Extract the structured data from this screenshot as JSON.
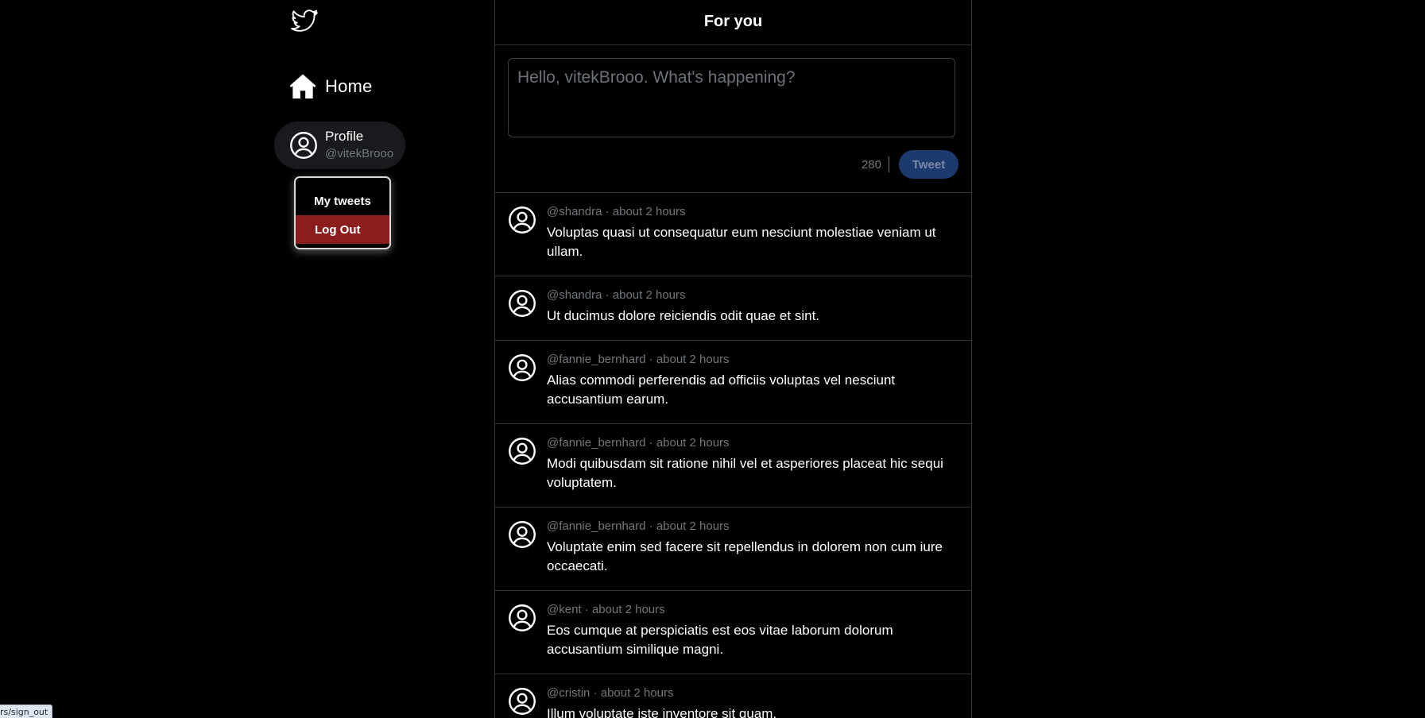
{
  "sidebar": {
    "home_label": "Home",
    "profile": {
      "name": "Profile",
      "handle": "@vitekBrooo"
    },
    "dropdown": {
      "my_tweets": "My tweets",
      "log_out": "Log Out"
    }
  },
  "main": {
    "title": "For you",
    "composer": {
      "placeholder": "Hello, vitekBrooo. What's happening?",
      "char_count": "280",
      "tweet_button": "Tweet"
    },
    "tweets": [
      {
        "meta": "@shandra · about 2 hours",
        "text": "Voluptas quasi ut consequatur eum nesciunt molestiae veniam ut ullam."
      },
      {
        "meta": "@shandra · about 2 hours",
        "text": "Ut ducimus dolore reiciendis odit quae et sint."
      },
      {
        "meta": "@fannie_bernhard · about 2 hours",
        "text": "Alias commodi perferendis ad officiis voluptas vel nesciunt accusantium earum."
      },
      {
        "meta": "@fannie_bernhard · about 2 hours",
        "text": "Modi quibusdam sit ratione nihil vel et asperiores placeat hic sequi voluptatem."
      },
      {
        "meta": "@fannie_bernhard · about 2 hours",
        "text": "Voluptate enim sed facere sit repellendus in dolorem non cum iure occaecati."
      },
      {
        "meta": "@kent · about 2 hours",
        "text": "Eos cumque at perspiciatis est eos vitae laborum dolorum accusantium similique magni."
      },
      {
        "meta": "@cristin · about 2 hours",
        "text": "Illum voluptate iste inventore sit quam."
      }
    ]
  },
  "statusbar": {
    "url": "rs/sign_out"
  },
  "colors": {
    "background": "#000000",
    "border": "#2f3336",
    "muted": "#71767b",
    "tweet_button_bg": "#1d3a6e",
    "logout_bg": "#8b1d1d",
    "profile_pill_bg": "#191a1e"
  },
  "icons": {
    "logo": "twitter-bird-icon",
    "home": "home-icon",
    "profile": "user-circle-icon",
    "tweet_avatar": "user-circle-icon"
  }
}
